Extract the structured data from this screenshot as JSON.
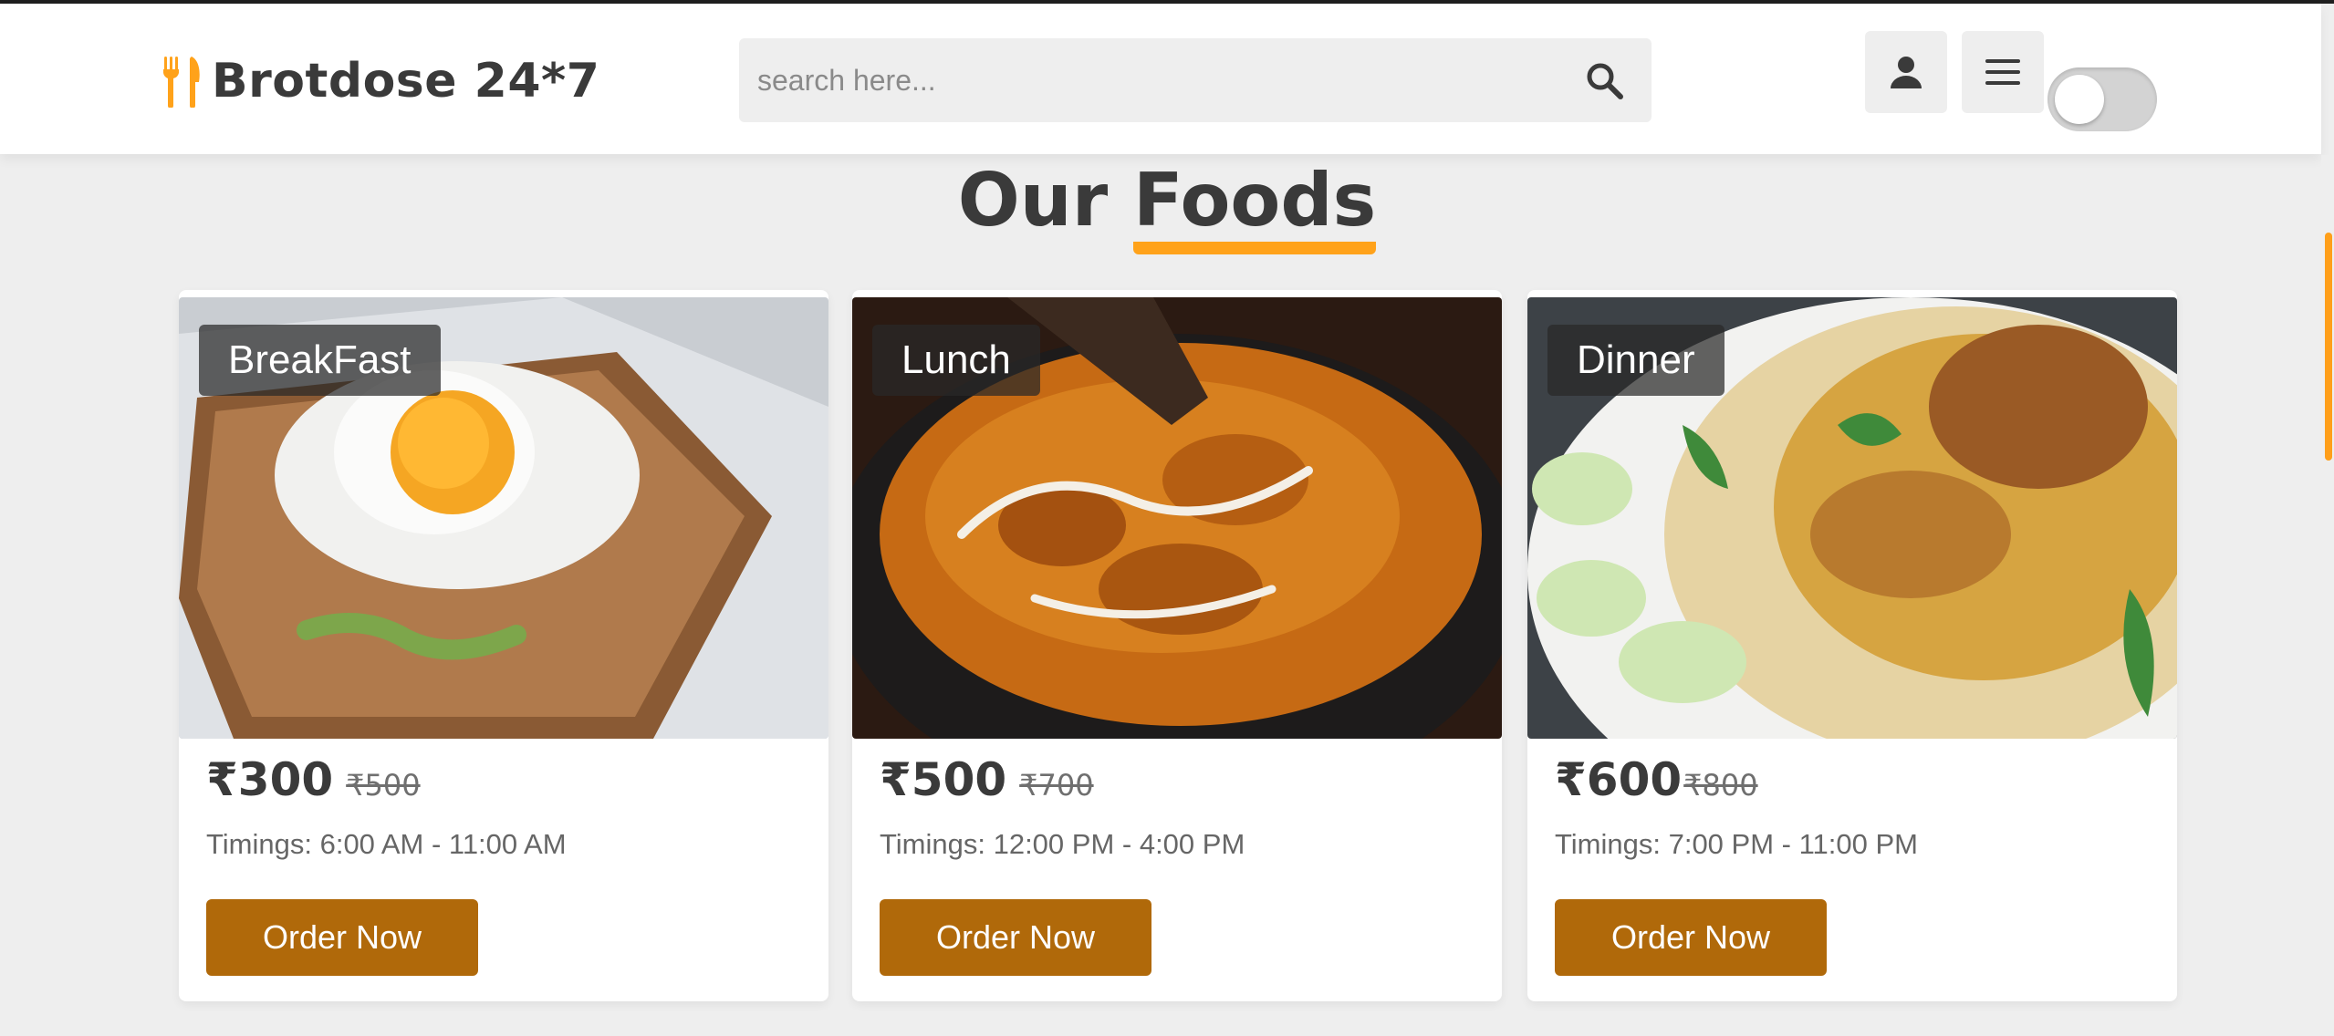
{
  "header": {
    "logo_text": "Brotdose 24*7",
    "search_placeholder": "search here...",
    "user_icon": "user-icon",
    "menu_icon": "menu-icon",
    "toggle_state": "off"
  },
  "colors": {
    "accent": "#ffa21a",
    "button": "#b0690a",
    "text": "#3a3a3a",
    "background": "#eeeeee"
  },
  "section": {
    "title_part1": "Our",
    "title_part2": "Foods"
  },
  "foods": [
    {
      "category": "BreakFast",
      "price": "₹300",
      "old_price": "₹500",
      "timings": "Timings: 6:00 AM - 11:00 AM",
      "button": "Order Now"
    },
    {
      "category": "Lunch",
      "price": "₹500",
      "old_price": "₹700",
      "timings": "Timings: 12:00 PM - 4:00 PM",
      "button": "Order Now"
    },
    {
      "category": "Dinner",
      "price": "₹600",
      "old_price": "₹800",
      "timings": "Timings: 7:00 PM - 11:00 PM",
      "button": "Order Now"
    }
  ]
}
